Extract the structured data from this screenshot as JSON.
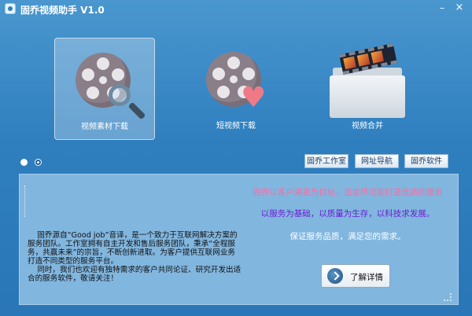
{
  "window": {
    "title": "固乔视频助手 V1.0",
    "minimize_glyph": "–",
    "close_glyph": "×"
  },
  "toolbar": {
    "items": [
      {
        "label": "视频素材下载",
        "icon": "film-reel-magnifier-icon",
        "active": true
      },
      {
        "label": "短视频下载",
        "icon": "film-reel-heart-icon",
        "active": false
      },
      {
        "label": "视频合并",
        "icon": "folder-film-icon",
        "active": false
      }
    ]
  },
  "page_indicator": {
    "count": 2,
    "selected": 0
  },
  "links": {
    "studio": "固乔工作室",
    "nav": "网址导航",
    "software": "固乔软件"
  },
  "info_panel": {
    "about": "    固乔源自“Good job”音译，是一个致力于互联网解决方案的服务团队。工作室拥有自主开发和售后服务团队，秉承“全程服务，共赢未来”的宗旨，不断创新进取。为客户提供互联网业务打造不同类型的服务平台。\n    同时，我们也欢迎有独特需求的客户共同论证、研究开发出适合的服务软件，敬请关注！",
    "slogans": [
      "固乔以客户满意为目标，追求尽可能打造优质的服务",
      "以服务为基础，以质量为生存，以科技求发展。",
      "保证服务品质，满足您的需求。"
    ],
    "detail_button": "了解详情"
  },
  "colors": {
    "background": "#2f7fbf",
    "panel": "#81b6df",
    "slogan_pink": "#ff6aa0",
    "slogan_purple": "#6b1fcf",
    "slogan_white": "#ffffff"
  }
}
